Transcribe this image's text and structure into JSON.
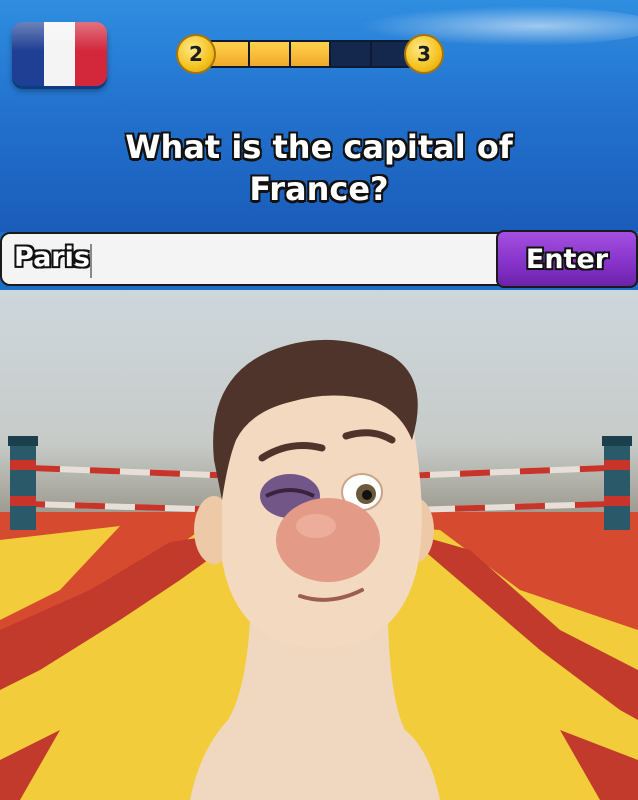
{
  "header": {
    "flag_icon": "france-flag-icon",
    "flag_colors": [
      "#1e3f94",
      "#f4f4f4",
      "#d3273c"
    ]
  },
  "progress": {
    "current_level": "2",
    "next_level": "3",
    "segments_total": 5,
    "segments_filled": 3
  },
  "question": {
    "text": "What is the capital of France?"
  },
  "answer": {
    "value": "Paris",
    "enter_label": "Enter"
  },
  "scene": {
    "description_icon": "boxing-ring-character"
  },
  "colors": {
    "header_blue": "#2373cf",
    "enter_purple": "#8532c9",
    "progress_gold": "#f2a92a",
    "ring_yellow": "#f2cc3a",
    "ring_red": "#c83a2e"
  }
}
